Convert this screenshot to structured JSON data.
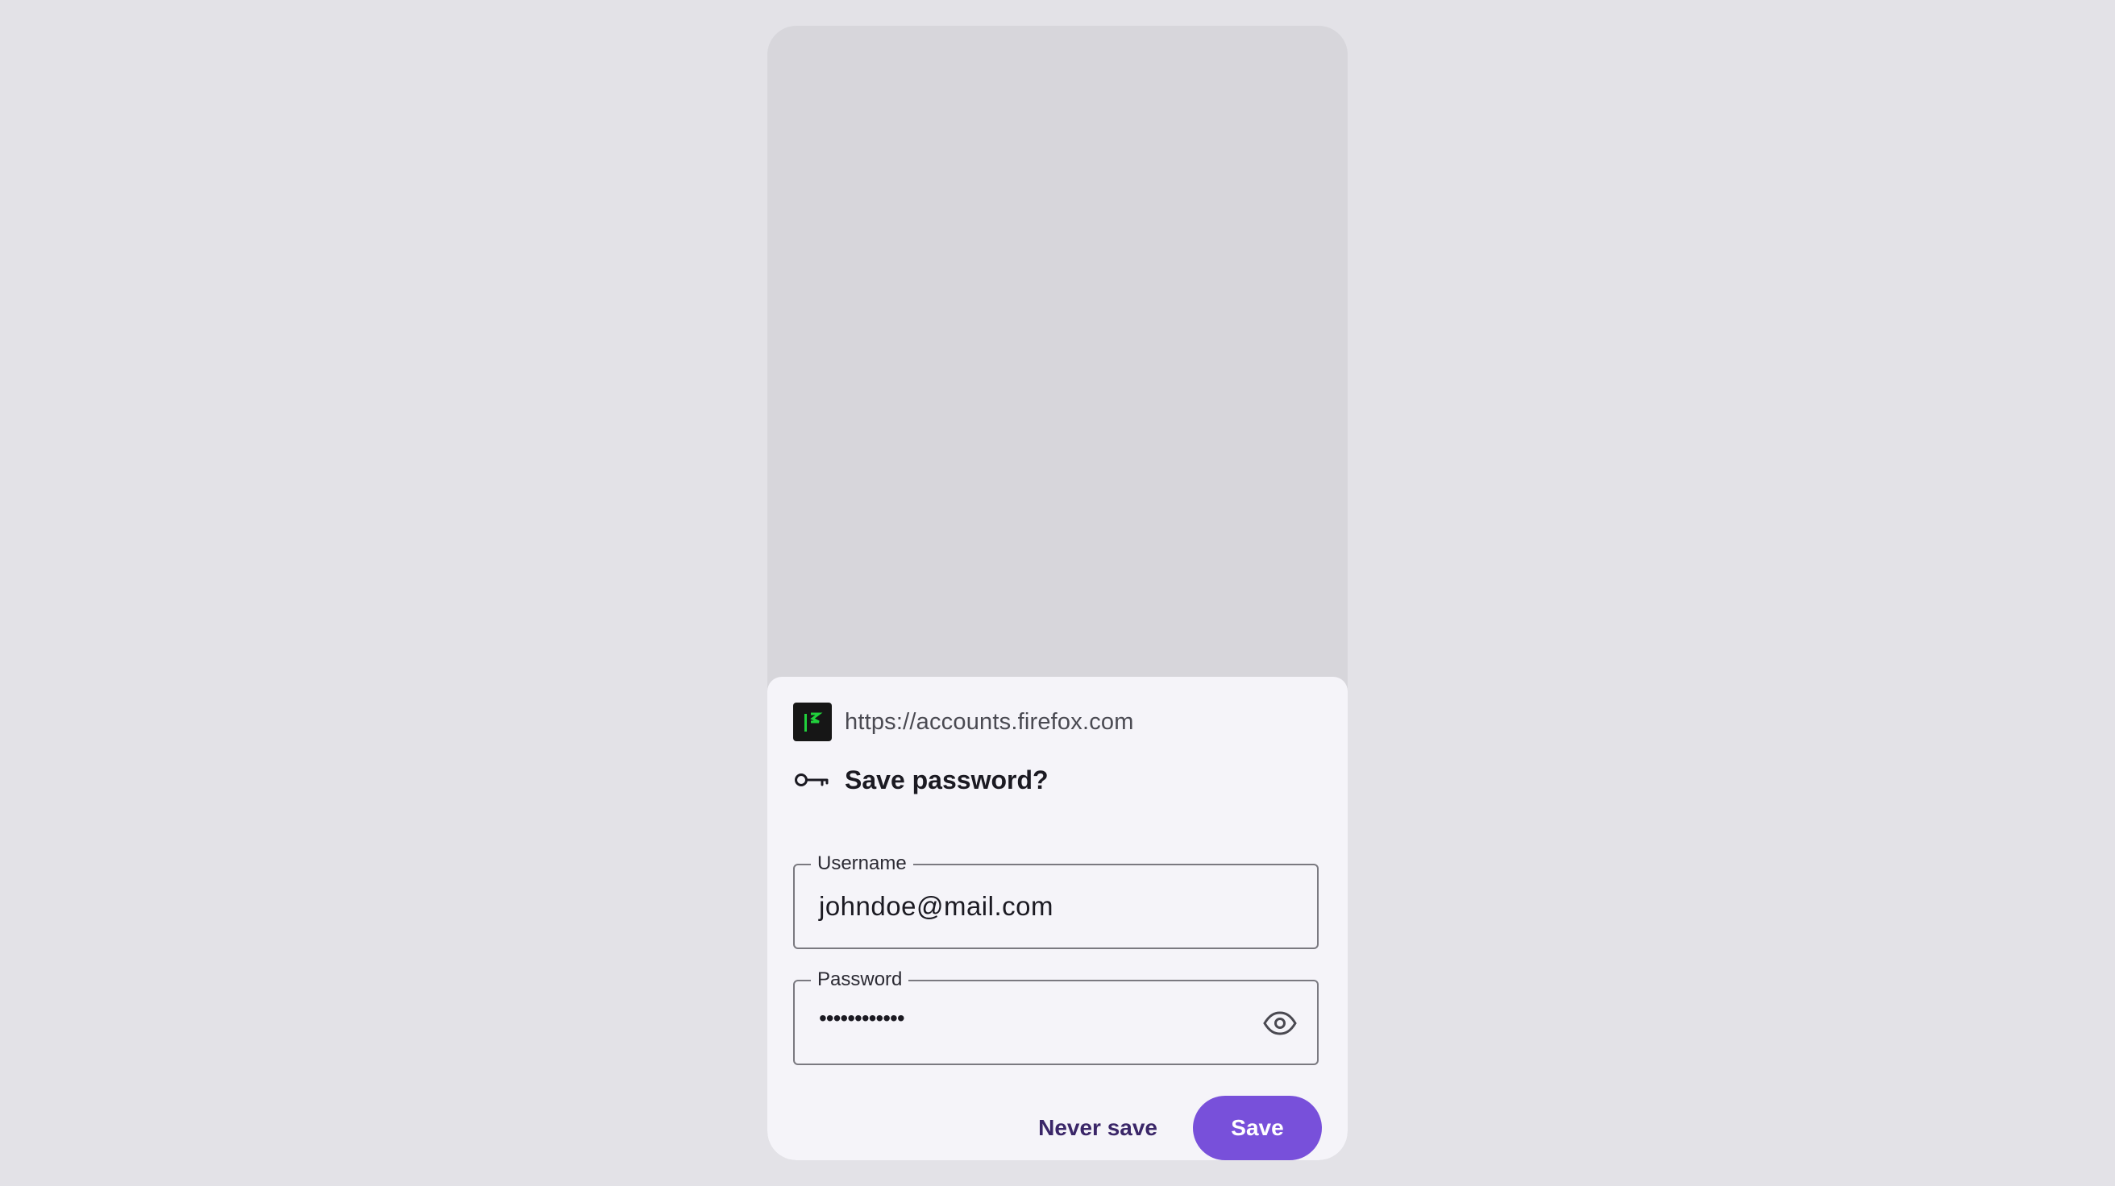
{
  "site": {
    "url": "https://accounts.firefox.com",
    "favicon": "firefox-accounts-favicon"
  },
  "dialog": {
    "title": "Save password?",
    "title_icon": "key-icon"
  },
  "username_field": {
    "label": "Username",
    "value": "johndoe@mail.com"
  },
  "password_field": {
    "label": "Password",
    "value": "••••••••••••",
    "toggle_icon": "eye-icon"
  },
  "actions": {
    "never_save_label": "Never save",
    "save_label": "Save"
  },
  "colors": {
    "accent": "#7850da",
    "secondary_text_button": "#3a2668",
    "background": "#e3e2e7",
    "sheet": "#f5f4f9",
    "scrim": "#d7d6db"
  }
}
